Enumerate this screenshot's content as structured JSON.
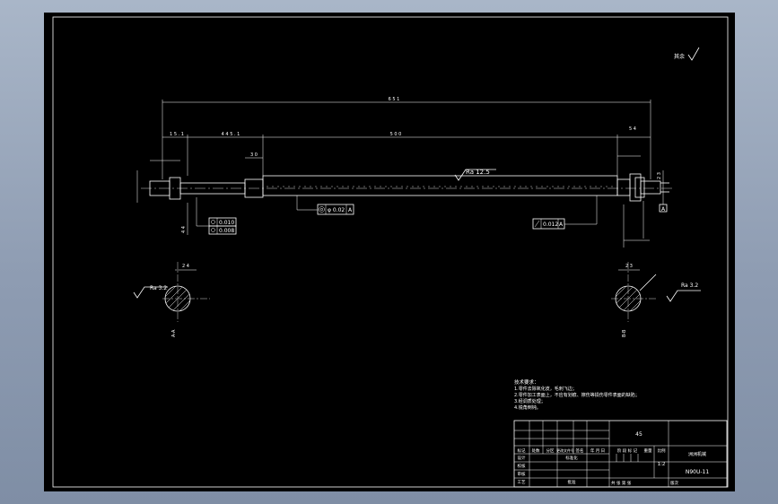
{
  "drawing": {
    "dims": {
      "overall": "6 5 1",
      "left_seg": "1 5 . 1",
      "mid_seg": "4 4 5 . 1",
      "long_seg": "5 0 0",
      "right_seg": "5 4",
      "step": "3 0",
      "d1": "4 4",
      "d2": "2 3"
    },
    "roughness_main": "Ra 12.5",
    "roughness_left": "Ra 3.2",
    "roughness_right": "Ra 3.2",
    "roughness_corner": "其余",
    "tol_flat1": "0.010",
    "tol_flat2": "0.008",
    "tol_coax": "φ 0.02",
    "tol_coax_ref": "A",
    "tol_runout": "0.012",
    "tol_runout_ref": "A",
    "datum": "A",
    "section_left": "A-A",
    "section_right": "B-B",
    "sec_left_dim": "2 4",
    "sec_right_dim": "2 3"
  },
  "notes": {
    "title": "技术要求：",
    "items": [
      "1.零件去除氧化皮，毛刺飞边；",
      "2.零件加工表面上，不应有划痕、擦伤等损伤零件表面的缺陷；",
      "3.经调质处理；",
      "4.锐角倒钝。"
    ]
  },
  "title_block": {
    "material": "45",
    "company": "洲洲机械",
    "drawing_no": "N90U-11",
    "scale": "1:2",
    "scale_label": "比例",
    "weight_label": "重量",
    "stage_label": "阶 段 标 记",
    "change_labels": [
      "标记",
      "处数",
      "分区",
      "更改文件号",
      "签名",
      "年 月 日"
    ],
    "role_labels": [
      "设计",
      "校核",
      "审核",
      "工艺"
    ],
    "std_label": "标准化",
    "approve_label": "批准",
    "footer_left": "共  张  第  张",
    "footer_right": "版次"
  }
}
